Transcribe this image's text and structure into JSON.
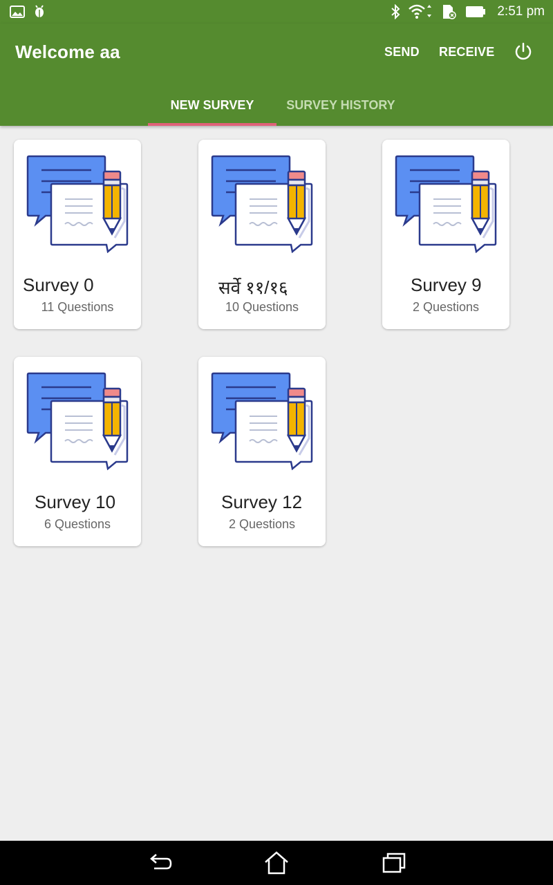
{
  "status_bar": {
    "time": "2:51 pm",
    "left_icons": [
      "image-icon",
      "android-debug-icon"
    ],
    "right_icons": [
      "bluetooth-icon",
      "wifi-icon",
      "sdcard-icon",
      "battery-icon"
    ]
  },
  "app_bar": {
    "title": "Welcome aa",
    "actions": {
      "send": "SEND",
      "receive": "RECEIVE"
    },
    "power_icon": "power-icon",
    "color": "#558b2f"
  },
  "tabs": [
    {
      "label": "NEW SURVEY",
      "active": true
    },
    {
      "label": "SURVEY HISTORY",
      "active": false
    }
  ],
  "tab_indicator_color": "#e0627a",
  "surveys": [
    {
      "name": "Survey 0",
      "questions": "11 Questions"
    },
    {
      "name": "सर्वे ११/१६",
      "questions": "10 Questions"
    },
    {
      "name": "Survey 9",
      "questions": "2 Questions"
    },
    {
      "name": "Survey 10",
      "questions": "6 Questions"
    },
    {
      "name": "Survey 12",
      "questions": "2 Questions"
    }
  ],
  "nav_bar": {
    "icons": [
      "back-icon",
      "home-icon",
      "recents-icon"
    ]
  }
}
